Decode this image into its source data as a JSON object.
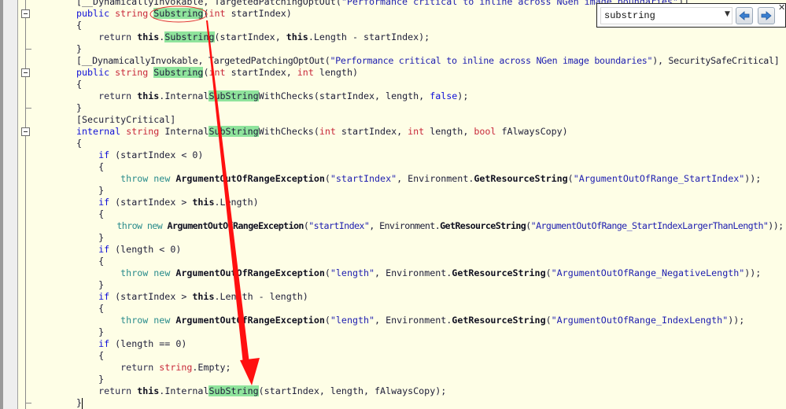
{
  "search": {
    "query": "substring",
    "icons": {
      "dropdown": "chevron-down-icon",
      "previous": "arrow-left-icon",
      "next": "arrow-right-icon",
      "close": "close-icon"
    }
  },
  "annotation_color": "#ff0000",
  "highlight_color": "#8fe49c",
  "code": [
    [
      [
        "[__DynamicallyInvokable, TargetedPatchingOptOut(",
        ""
      ],
      [
        "\"Performance critical to inline across NGen image boundaries\"",
        "str"
      ],
      [
        ")]",
        ""
      ]
    ],
    [
      [
        "public",
        "kw"
      ],
      [
        " ",
        ""
      ],
      [
        "string",
        "ty"
      ],
      [
        " ",
        ""
      ],
      [
        "Substring",
        "hl"
      ],
      [
        "(",
        ""
      ],
      [
        "int",
        "ty"
      ],
      [
        " startIndex)",
        ""
      ]
    ],
    [
      [
        "{",
        ""
      ]
    ],
    [
      [
        "    ",
        ""
      ],
      [
        "return",
        "ret"
      ],
      [
        " ",
        ""
      ],
      [
        "this",
        "b"
      ],
      [
        ".",
        ""
      ],
      [
        "Substring",
        "hl"
      ],
      [
        "(startIndex, ",
        ""
      ],
      [
        "this",
        "b"
      ],
      [
        ".Length - startIndex);",
        ""
      ]
    ],
    [
      [
        "}",
        ""
      ]
    ],
    [
      [
        "[__DynamicallyInvokable, TargetedPatchingOptOut(",
        ""
      ],
      [
        "\"Performance critical to inline across NGen image boundaries\"",
        "str"
      ],
      [
        "), SecuritySafeCritical]",
        ""
      ]
    ],
    [
      [
        "public",
        "kw"
      ],
      [
        " ",
        ""
      ],
      [
        "string",
        "ty"
      ],
      [
        " ",
        ""
      ],
      [
        "Substring",
        "hl"
      ],
      [
        "(",
        ""
      ],
      [
        "int",
        "ty"
      ],
      [
        " startIndex, ",
        ""
      ],
      [
        "int",
        "ty"
      ],
      [
        " length)",
        ""
      ]
    ],
    [
      [
        "{",
        ""
      ]
    ],
    [
      [
        "    ",
        ""
      ],
      [
        "return",
        "ret"
      ],
      [
        " ",
        ""
      ],
      [
        "this",
        "b"
      ],
      [
        ".Internal",
        ""
      ],
      [
        "SubString",
        "hl"
      ],
      [
        "WithChecks(startIndex, length, ",
        ""
      ],
      [
        "false",
        "kw"
      ],
      [
        ");",
        ""
      ]
    ],
    [
      [
        "}",
        ""
      ]
    ],
    [
      [
        "[SecurityCritical]",
        ""
      ]
    ],
    [
      [
        "internal",
        "kw"
      ],
      [
        " ",
        ""
      ],
      [
        "string",
        "ty"
      ],
      [
        " Internal",
        ""
      ],
      [
        "SubString",
        "hl"
      ],
      [
        "WithChecks(",
        ""
      ],
      [
        "int",
        "ty"
      ],
      [
        " startIndex, ",
        ""
      ],
      [
        "int",
        "ty"
      ],
      [
        " length, ",
        ""
      ],
      [
        "bool",
        "ty"
      ],
      [
        " fAlwaysCopy)",
        ""
      ]
    ],
    [
      [
        "{",
        ""
      ]
    ],
    [
      [
        "    ",
        ""
      ],
      [
        "if",
        "kw"
      ],
      [
        " (startIndex < 0)",
        ""
      ]
    ],
    [
      [
        "    {",
        ""
      ]
    ],
    [
      [
        "        ",
        ""
      ],
      [
        "throw",
        "ctl"
      ],
      [
        " ",
        ""
      ],
      [
        "new",
        "ctl"
      ],
      [
        " ",
        ""
      ],
      [
        "ArgumentOutOfRangeException",
        "b"
      ],
      [
        "(",
        ""
      ],
      [
        "\"startIndex\"",
        "str"
      ],
      [
        ", Environment.",
        ""
      ],
      [
        "GetResourceString",
        "b"
      ],
      [
        "(",
        ""
      ],
      [
        "\"ArgumentOutOfRange_StartIndex\"",
        "str"
      ],
      [
        "));",
        ""
      ]
    ],
    [
      [
        "    }",
        ""
      ]
    ],
    [
      [
        "    ",
        ""
      ],
      [
        "if",
        "kw"
      ],
      [
        " (startIndex > ",
        ""
      ],
      [
        "this",
        "b"
      ],
      [
        ".Length)",
        ""
      ]
    ],
    [
      [
        "    {",
        ""
      ]
    ],
    [
      [
        "        ",
        ""
      ],
      [
        "throw",
        "ctl"
      ],
      [
        " ",
        ""
      ],
      [
        "new",
        "ctl"
      ],
      [
        " ",
        ""
      ],
      [
        "ArgumentOutOfRangeException",
        "b"
      ],
      [
        "(",
        ""
      ],
      [
        "\"startIndex\"",
        "str"
      ],
      [
        ", Environment.",
        ""
      ],
      [
        "GetResourceString",
        "b"
      ],
      [
        "(",
        ""
      ],
      [
        "\"ArgumentOutOfRange_StartIndexLargerThanLength\"",
        "str"
      ],
      [
        "));",
        ""
      ]
    ],
    [
      [
        "    }",
        ""
      ]
    ],
    [
      [
        "    ",
        ""
      ],
      [
        "if",
        "kw"
      ],
      [
        " (length < 0)",
        ""
      ]
    ],
    [
      [
        "    {",
        ""
      ]
    ],
    [
      [
        "        ",
        ""
      ],
      [
        "throw",
        "ctl"
      ],
      [
        " ",
        ""
      ],
      [
        "new",
        "ctl"
      ],
      [
        " ",
        ""
      ],
      [
        "ArgumentOutOfRangeException",
        "b"
      ],
      [
        "(",
        ""
      ],
      [
        "\"length\"",
        "str"
      ],
      [
        ", Environment.",
        ""
      ],
      [
        "GetResourceString",
        "b"
      ],
      [
        "(",
        ""
      ],
      [
        "\"ArgumentOutOfRange_NegativeLength\"",
        "str"
      ],
      [
        "));",
        ""
      ]
    ],
    [
      [
        "    }",
        ""
      ]
    ],
    [
      [
        "    ",
        ""
      ],
      [
        "if",
        "kw"
      ],
      [
        " (startIndex > ",
        ""
      ],
      [
        "this",
        "b"
      ],
      [
        ".Length - length)",
        ""
      ]
    ],
    [
      [
        "    {",
        ""
      ]
    ],
    [
      [
        "        ",
        ""
      ],
      [
        "throw",
        "ctl"
      ],
      [
        " ",
        ""
      ],
      [
        "new",
        "ctl"
      ],
      [
        " ",
        ""
      ],
      [
        "ArgumentOutOfRangeException",
        "b"
      ],
      [
        "(",
        ""
      ],
      [
        "\"length\"",
        "str"
      ],
      [
        ", Environment.",
        ""
      ],
      [
        "GetResourceString",
        "b"
      ],
      [
        "(",
        ""
      ],
      [
        "\"ArgumentOutOfRange_IndexLength\"",
        "str"
      ],
      [
        "));",
        ""
      ]
    ],
    [
      [
        "    }",
        ""
      ]
    ],
    [
      [
        "    ",
        ""
      ],
      [
        "if",
        "kw"
      ],
      [
        " (length == 0)",
        ""
      ]
    ],
    [
      [
        "    {",
        ""
      ]
    ],
    [
      [
        "        ",
        ""
      ],
      [
        "return",
        "ret"
      ],
      [
        " ",
        ""
      ],
      [
        "string",
        "ty"
      ],
      [
        ".Empty;",
        ""
      ]
    ],
    [
      [
        "    }",
        ""
      ]
    ],
    [
      [
        "    ",
        ""
      ],
      [
        "return",
        "ret"
      ],
      [
        " ",
        ""
      ],
      [
        "this",
        "b"
      ],
      [
        ".Internal",
        ""
      ],
      [
        "SubString",
        "hl"
      ],
      [
        "(startIndex, length, fAlwaysCopy);",
        ""
      ]
    ],
    [
      [
        "}",
        ""
      ]
    ]
  ]
}
